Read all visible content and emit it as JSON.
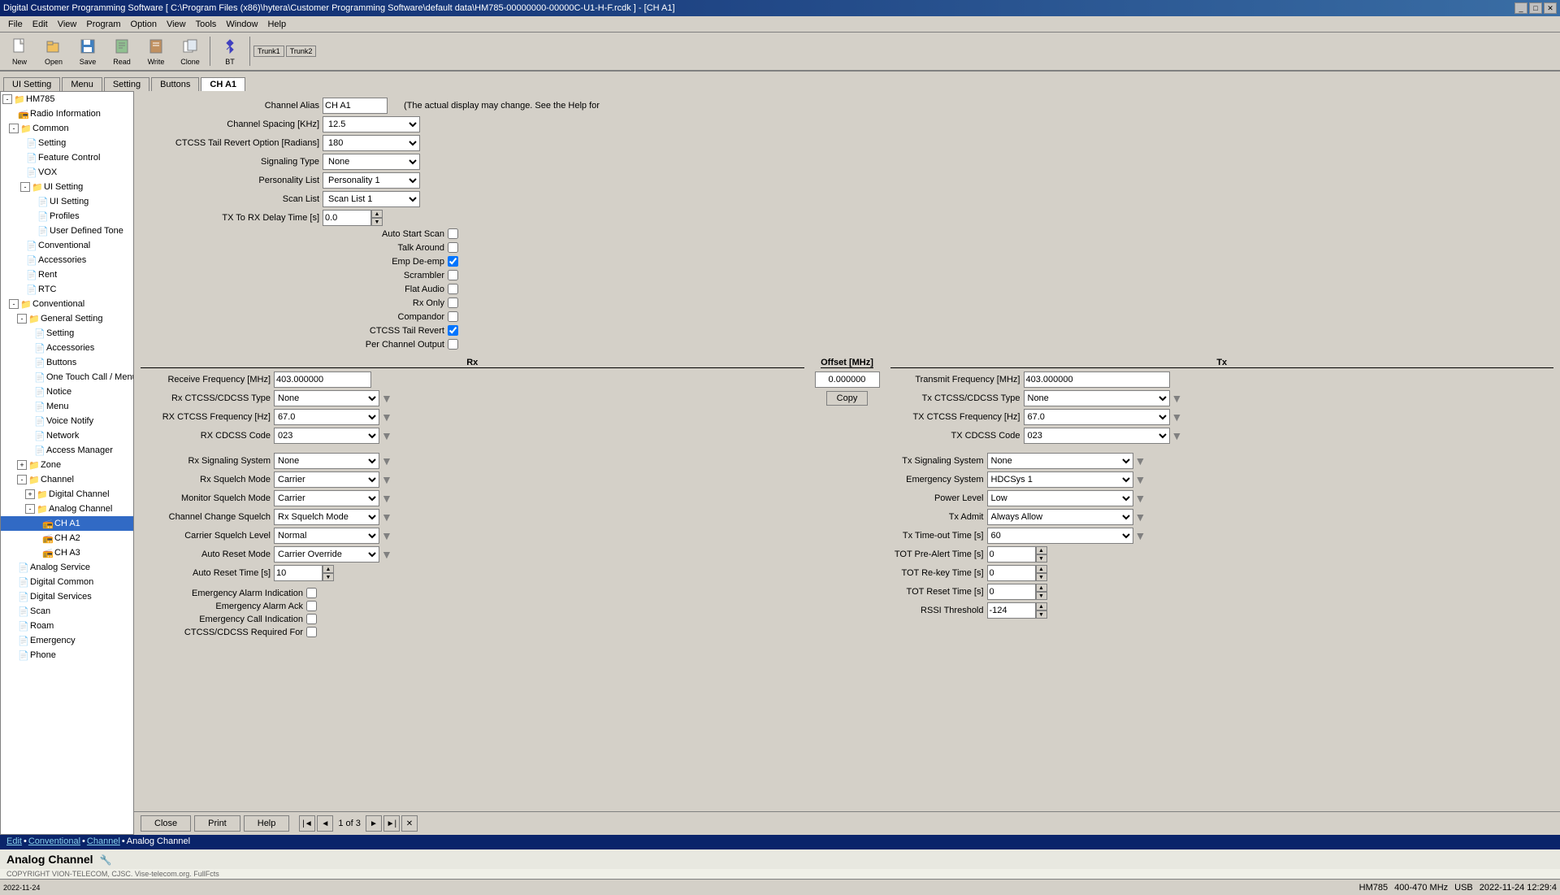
{
  "titlebar": {
    "title": "Digital Customer Programming Software [ C:\\Program Files (x86)\\hytera\\Customer Programming Software\\default data\\HM785-00000000-00000C-U1-H-F.rcdk ] - [CH A1]",
    "controls": [
      "_",
      "□",
      "✕"
    ]
  },
  "menubar": {
    "items": [
      "File",
      "Edit",
      "View",
      "Program",
      "Option",
      "View",
      "Tools",
      "Window",
      "Help"
    ]
  },
  "toolbar": {
    "buttons": [
      {
        "label": "New",
        "icon": "📄"
      },
      {
        "label": "Open",
        "icon": "📂"
      },
      {
        "label": "Save",
        "icon": "💾"
      },
      {
        "label": "Read",
        "icon": "📖"
      },
      {
        "label": "Write",
        "icon": "✏️"
      },
      {
        "label": "Clone",
        "icon": "⧉"
      },
      {
        "label": "BT",
        "icon": "⬡"
      }
    ],
    "trunk_labels": [
      "Trunk1",
      "Trunk2"
    ]
  },
  "tabs": {
    "items": [
      "UI Setting",
      "Menu",
      "Setting",
      "Buttons",
      "CH A1"
    ],
    "active": "CH A1"
  },
  "tree": {
    "root": "HM785",
    "items": [
      {
        "label": "Radio Information",
        "indent": 2,
        "type": "item"
      },
      {
        "label": "Common",
        "indent": 1,
        "type": "folder",
        "expanded": true
      },
      {
        "label": "Setting",
        "indent": 3,
        "type": "item"
      },
      {
        "label": "Feature Control",
        "indent": 3,
        "type": "item"
      },
      {
        "label": "VOX",
        "indent": 3,
        "type": "item"
      },
      {
        "label": "UI Setting",
        "indent": 3,
        "type": "folder",
        "expanded": true
      },
      {
        "label": "UI Setting",
        "indent": 4,
        "type": "item"
      },
      {
        "label": "Profiles",
        "indent": 4,
        "type": "item"
      },
      {
        "label": "User Defined Tone",
        "indent": 4,
        "type": "item"
      },
      {
        "label": "Conventional",
        "indent": 3,
        "type": "item"
      },
      {
        "label": "Accessories",
        "indent": 3,
        "type": "item"
      },
      {
        "label": "Rent",
        "indent": 3,
        "type": "item"
      },
      {
        "label": "RTC",
        "indent": 3,
        "type": "item"
      },
      {
        "label": "Conventional",
        "indent": 1,
        "type": "folder",
        "expanded": true
      },
      {
        "label": "General Setting",
        "indent": 2,
        "type": "folder",
        "expanded": true
      },
      {
        "label": "Setting",
        "indent": 4,
        "type": "item"
      },
      {
        "label": "Accessories",
        "indent": 4,
        "type": "item"
      },
      {
        "label": "Buttons",
        "indent": 4,
        "type": "item"
      },
      {
        "label": "One Touch Call / Menu",
        "indent": 4,
        "type": "item"
      },
      {
        "label": "Notice",
        "indent": 4,
        "type": "item"
      },
      {
        "label": "Menu",
        "indent": 4,
        "type": "item"
      },
      {
        "label": "Voice Notify",
        "indent": 4,
        "type": "item"
      },
      {
        "label": "Network",
        "indent": 4,
        "type": "item"
      },
      {
        "label": "Access Manager",
        "indent": 4,
        "type": "item"
      },
      {
        "label": "Zone",
        "indent": 2,
        "type": "folder",
        "expanded": false
      },
      {
        "label": "Channel",
        "indent": 2,
        "type": "folder",
        "expanded": true
      },
      {
        "label": "Digital Channel",
        "indent": 3,
        "type": "folder",
        "expanded": false
      },
      {
        "label": "Analog Channel",
        "indent": 3,
        "type": "folder",
        "expanded": true
      },
      {
        "label": "CH A1",
        "indent": 4,
        "type": "item",
        "selected": true
      },
      {
        "label": "CH A2",
        "indent": 4,
        "type": "item"
      },
      {
        "label": "CH A3",
        "indent": 4,
        "type": "item"
      },
      {
        "label": "Analog Service",
        "indent": 2,
        "type": "item"
      },
      {
        "label": "Digital Common",
        "indent": 2,
        "type": "item"
      },
      {
        "label": "Digital Services",
        "indent": 2,
        "type": "item"
      },
      {
        "label": "Scan",
        "indent": 2,
        "type": "item"
      },
      {
        "label": "Roam",
        "indent": 2,
        "type": "item"
      },
      {
        "label": "Emergency",
        "indent": 2,
        "type": "item"
      },
      {
        "label": "Phone",
        "indent": 2,
        "type": "item"
      }
    ]
  },
  "form": {
    "channel_alias_label": "Channel Alias",
    "channel_alias_value": "CH A1",
    "channel_alias_note": "(The actual display may change. See the Help for",
    "channel_spacing_label": "Channel Spacing [KHz]",
    "channel_spacing_value": "12.5",
    "ctcss_tail_revert_label": "CTCSS Tail Revert Option [Radians]",
    "ctcss_tail_revert_value": "180",
    "signaling_type_label": "Signaling Type",
    "signaling_type_value": "None",
    "personality_list_label": "Personality List",
    "personality_list_value": "Personality 1",
    "scan_list_label": "Scan List",
    "scan_list_value": "Scan List 1",
    "tx_rx_delay_label": "TX To RX Delay Time [s]",
    "tx_rx_delay_value": "0.0",
    "auto_start_scan_label": "Auto Start Scan",
    "talk_around_label": "Talk Around",
    "emp_de_emp_label": "Emp De-emp",
    "scrambler_label": "Scrambler",
    "flat_audio_label": "Flat Audio",
    "rx_only_label": "Rx Only",
    "compandor_label": "Compandor",
    "ctcss_tail_revert_chk_label": "CTCSS Tail Revert",
    "per_channel_output_label": "Per Channel Output",
    "rx_section_title": "Rx",
    "tx_section_title": "Tx",
    "offset_section_title": "Offset [MHz]",
    "rx_freq_label": "Receive Frequency [MHz]",
    "rx_freq_value": "403.000000",
    "rx_ctcss_label": "Rx CTCSS/CDCSS Type",
    "rx_ctcss_value": "None",
    "rx_ctcss_freq_label": "RX CTCSS Frequency [Hz]",
    "rx_ctcss_freq_value": "67.0",
    "rx_cdcss_label": "RX CDCSS Code",
    "rx_cdcss_value": "023",
    "offset_value": "0.000000",
    "copy_btn": "Copy",
    "tx_freq_label": "Transmit Frequency [MHz]",
    "tx_freq_value": "403.000000",
    "tx_ctcss_label": "Tx CTCSS/CDCSS Type",
    "tx_ctcss_value": "None",
    "tx_ctcss_freq_label": "TX CTCSS Frequency [Hz]",
    "tx_ctcss_freq_value": "67.0",
    "tx_cdcss_label": "TX CDCSS Code",
    "tx_cdcss_value": "023",
    "rx_signaling_label": "Rx Signaling System",
    "rx_signaling_value": "None",
    "tx_signaling_label": "Tx Signaling System",
    "tx_signaling_value": "None",
    "rx_squelch_label": "Rx Squelch Mode",
    "rx_squelch_value": "Carrier",
    "emergency_system_label": "Emergency System",
    "emergency_system_value": "HDCSys 1",
    "monitor_squelch_label": "Monitor Squelch Mode",
    "monitor_squelch_value": "Carrier",
    "power_level_label": "Power Level",
    "power_level_value": "Low",
    "channel_change_label": "Channel Change Squelch",
    "channel_change_value": "Rx Squelch Mode",
    "tx_admit_label": "Tx Admit",
    "tx_admit_value": "Always Allow",
    "carrier_squelch_label": "Carrier Squelch Level",
    "carrier_squelch_value": "Normal",
    "tx_timeout_label": "Tx Time-out Time [s]",
    "tx_timeout_value": "60",
    "auto_reset_label": "Auto Reset Mode",
    "auto_reset_value": "Carrier Override",
    "tot_pre_alert_label": "TOT Pre-Alert Time [s]",
    "tot_pre_alert_value": "0",
    "auto_reset_time_label": "Auto Reset Time [s]",
    "auto_reset_time_value": "10",
    "tot_rekey_label": "TOT Re-key Time [s]",
    "tot_rekey_value": "0",
    "tot_reset_label": "TOT Reset Time [s]",
    "tot_reset_value": "0",
    "rssi_threshold_label": "RSSI Threshold",
    "rssi_threshold_value": "-124",
    "emergency_alarm_ind_label": "Emergency Alarm Indication",
    "emergency_alarm_ack_label": "Emergency Alarm Ack",
    "emergency_call_ind_label": "Emergency Call Indication",
    "ctcss_cdcss_req_label": "CTCSS/CDCSS Required For"
  },
  "bottom_buttons": {
    "close": "Close",
    "print": "Print",
    "help": "Help",
    "page_indicator": "1 of 3"
  },
  "info_bar": {
    "edit": "Edit",
    "sep1": "•",
    "conventional": "Conventional",
    "sep2": "•",
    "channel": "Channel",
    "sep3": "•",
    "analog_channel": "Analog Channel"
  },
  "analog_heading": "Analog Channel",
  "copyright": "COPYRIGHT VION-TELECOM, CJSC. Vise-telecom.org. FullFcts",
  "statusbar": {
    "date_time": "2022-11-24 12:29:4",
    "model": "HM785",
    "freq": "400-470 MHz",
    "usb": "USB"
  }
}
